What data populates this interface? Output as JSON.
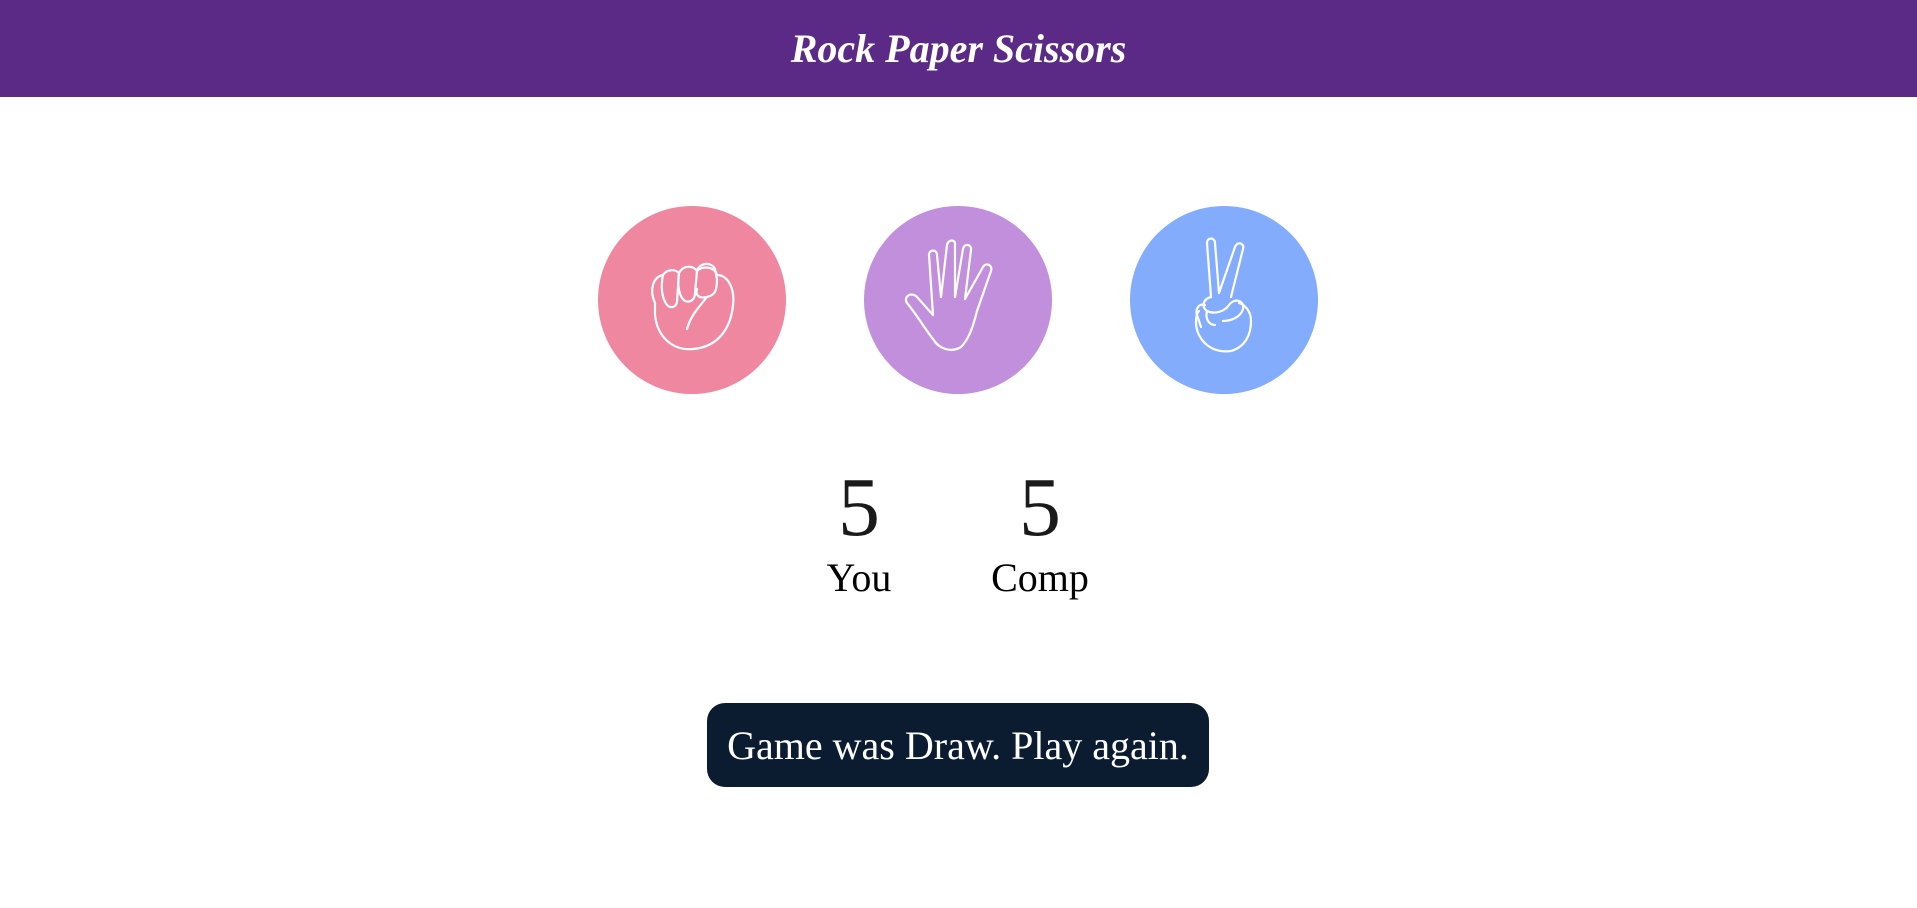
{
  "header": {
    "title": "Rock Paper Scissors",
    "bg_color": "#5a2a86"
  },
  "choices": [
    {
      "name": "rock",
      "icon": "fist-icon",
      "color": "#f087a1"
    },
    {
      "name": "paper",
      "icon": "open-hand-icon",
      "color": "#c28fdd"
    },
    {
      "name": "scissors",
      "icon": "peace-hand-icon",
      "color": "#83acfc"
    }
  ],
  "score": {
    "user": {
      "value": "5",
      "label": "You"
    },
    "comp": {
      "value": "5",
      "label": "Comp"
    }
  },
  "result": {
    "message": "Game was Draw. Play again.",
    "bg_color": "#0b1b30"
  }
}
